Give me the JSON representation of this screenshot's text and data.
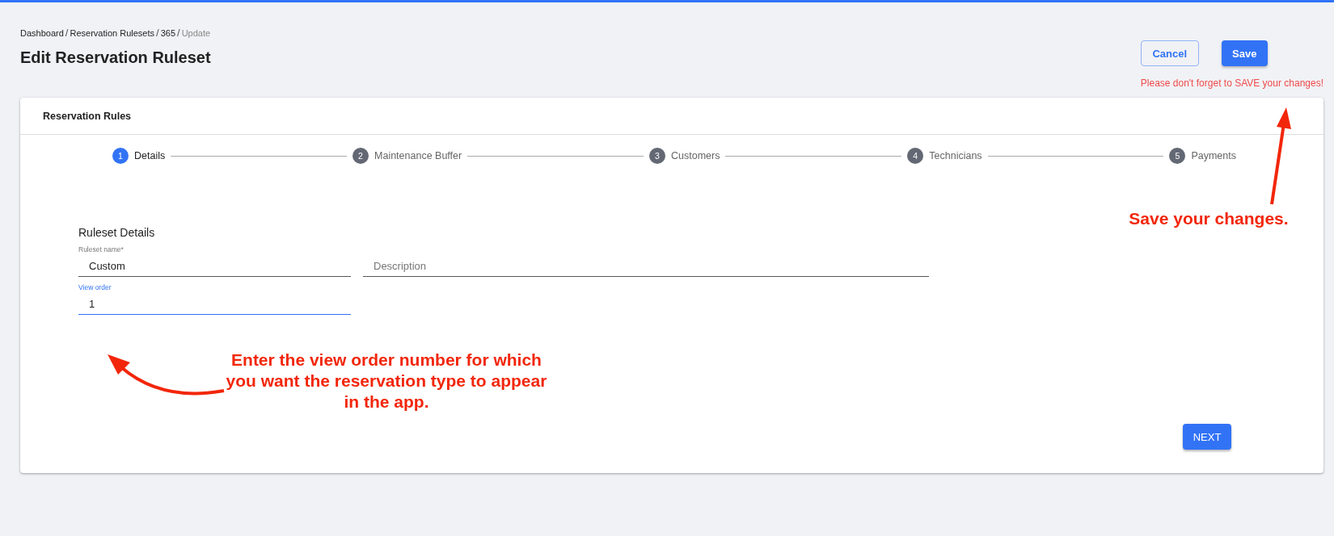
{
  "breadcrumb": [
    {
      "label": "Dashboard",
      "current": false
    },
    {
      "label": "Reservation Rulesets",
      "current": false
    },
    {
      "label": "365",
      "current": false
    },
    {
      "label": "Update",
      "current": true
    }
  ],
  "breadcrumb_separator": "/",
  "page_title": "Edit Reservation Ruleset",
  "buttons": [
    {
      "label": "Cancel",
      "kind": "outline"
    },
    {
      "label": "Save",
      "kind": "primary"
    }
  ],
  "save_reminder": "Please don't forget to SAVE your changes!",
  "card": {
    "title": "Reservation Rules",
    "steps": [
      {
        "number": "1",
        "label": "Details",
        "active": true
      },
      {
        "number": "2",
        "label": "Maintenance Buffer",
        "active": false
      },
      {
        "number": "3",
        "label": "Customers",
        "active": false
      },
      {
        "number": "4",
        "label": "Technicians",
        "active": false
      },
      {
        "number": "5",
        "label": "Payments",
        "active": false
      }
    ],
    "section_title": "Ruleset Details",
    "fields": [
      {
        "label": "Ruleset name*",
        "value": "Custom",
        "focused": false
      },
      {
        "placeholder": "Description",
        "focused": false
      },
      {
        "label": "View order",
        "value": "1",
        "focused": true
      }
    ],
    "next_button": "NEXT"
  },
  "annotations": [
    {
      "text": "Save your changes."
    },
    {
      "text": "Enter the view order number for which you want the reservation type to appear in the app."
    }
  ]
}
